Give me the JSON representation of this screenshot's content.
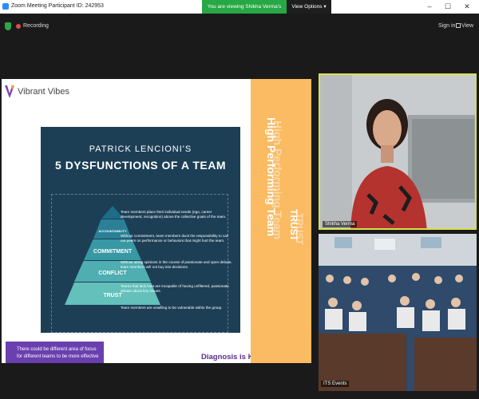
{
  "window": {
    "title": "Zoom Meeting Participant ID: 242953",
    "minimize": "–",
    "maximize": "☐",
    "close": "✕"
  },
  "share_banner": {
    "text": "You are viewing Shikha Verma's screen"
  },
  "view_options": {
    "label": "View Options",
    "chevron": "▾"
  },
  "toolbar": {
    "recording_label": "Recording",
    "sign_in_label": "Sign in",
    "view_label": "View"
  },
  "slide": {
    "brand": "Vibrant Vibes",
    "panel_title_1": "PATRICK LENCIONI'S",
    "panel_title_2": "5 DYSFUNCTIONS OF A TEAM",
    "pyramid": [
      {
        "label": "RESULTS",
        "desc": "Team members place their individual needs (ego, career development, recognition) above the collective goals of the team."
      },
      {
        "label": "ACCOUNTABILITY",
        "desc": "Without commitment, team members duck the responsibility to call out peers on performance or behaviors that might hurt the team."
      },
      {
        "label": "COMMITMENT",
        "desc": "Without airing opinions in the course of passionate and open debate, team members will not buy into decisions."
      },
      {
        "label": "CONFLICT",
        "desc": "Teams that lack trust are incapable of having unfiltered, passionate debate about key issues."
      },
      {
        "label": "TRUST",
        "desc": "Team members are unwilling to be vulnerable within the group."
      }
    ],
    "sidebar_main": "High Performing Team",
    "sidebar_shadow": "High Performing Team",
    "sidebar_trust": "TRUST",
    "sidebar_trust_shadow": "TRUST",
    "callout": "There could be different area of focus for different teams to be more effective",
    "diagnosis": "Diagnosis is Key!"
  },
  "participants": [
    {
      "name": "Shikha Verma"
    },
    {
      "name": "ITS Events"
    }
  ],
  "colors": {
    "accent_green": "#27a745",
    "sidebar": "#fbbb63",
    "panel": "#1c3f56",
    "callout": "#6a3fb0"
  }
}
